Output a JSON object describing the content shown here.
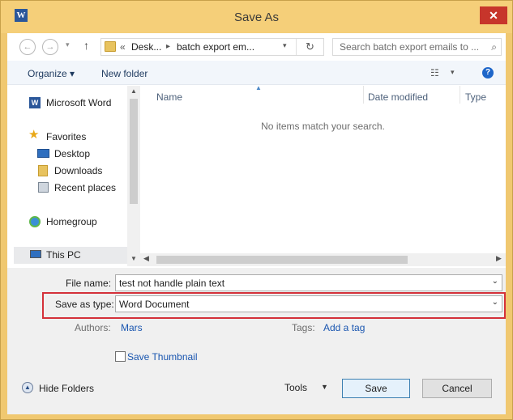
{
  "window": {
    "title": "Save As",
    "app_icon_letter": "W"
  },
  "address": {
    "back_icon": "back-arrow-icon",
    "forward_icon": "forward-arrow-icon",
    "up_icon": "up-arrow-icon",
    "overflow": "«",
    "crumbs": [
      "Desk...",
      "batch export em..."
    ],
    "search_placeholder": "Search batch export emails to ..."
  },
  "toolbar": {
    "organize": "Organize ▾",
    "new_folder": "New folder"
  },
  "nav": {
    "items": [
      {
        "label": "Microsoft Word",
        "icon": "word-icon"
      },
      {
        "label": "Favorites",
        "icon": "star-icon"
      },
      {
        "label": "Desktop",
        "icon": "desktop-icon"
      },
      {
        "label": "Downloads",
        "icon": "downloads-icon"
      },
      {
        "label": "Recent places",
        "icon": "recent-places-icon"
      },
      {
        "label": "Homegroup",
        "icon": "homegroup-icon"
      },
      {
        "label": "This PC",
        "icon": "pc-icon"
      }
    ]
  },
  "list": {
    "columns": [
      "Name",
      "Date modified",
      "Type"
    ],
    "empty_message": "No items match your search."
  },
  "form": {
    "file_name_label": "File name:",
    "file_name_value": "test not handle plain text",
    "save_type_label": "Save as type:",
    "save_type_value": "Word Document",
    "authors_label": "Authors:",
    "authors_value": "Mars",
    "tags_label": "Tags:",
    "tags_value": "Add a tag",
    "thumbnail_label": "Save Thumbnail"
  },
  "footer": {
    "hide_folders": "Hide Folders",
    "tools": "Tools",
    "save": "Save",
    "cancel": "Cancel"
  },
  "colors": {
    "title_bar": "#f5cf79",
    "highlight": "#d4313a",
    "link": "#1a56b0"
  }
}
